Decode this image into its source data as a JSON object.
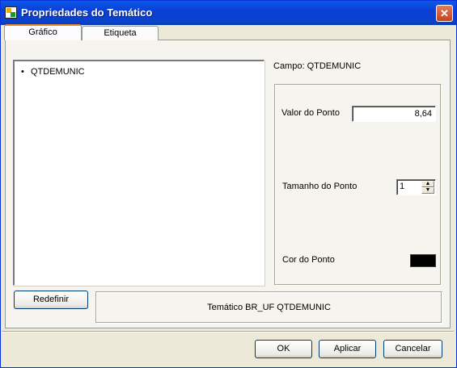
{
  "window": {
    "title": "Propriedades do Temático",
    "close_glyph": "✕"
  },
  "tabs": [
    {
      "label": "Gráfico",
      "active": true
    },
    {
      "label": "Etiqueta",
      "active": false
    }
  ],
  "fields_list": {
    "items": [
      {
        "bullet": "•",
        "label": "QTDEMUNIC"
      }
    ]
  },
  "campo": {
    "label": "Campo: QTDEMUNIC"
  },
  "props": {
    "valor_label": "Valor do Ponto",
    "valor_value": "8,64",
    "tamanho_label": "Tamanho do Ponto",
    "tamanho_value": "1",
    "cor_label": "Cor do Ponto",
    "cor_value": "#000000"
  },
  "buttons": {
    "redefinir": "Redefinir",
    "ok": "OK",
    "aplicar": "Aplicar",
    "cancelar": "Cancelar"
  },
  "status": {
    "text": "Temático BR_UF QTDEMUNIC"
  },
  "icons": {
    "app": "app-icon",
    "close": "close-icon",
    "spin_up": "spin-up-icon",
    "spin_down": "spin-down-icon"
  },
  "colors": {
    "title_bar": "#0b3fd6",
    "tab_highlight": "#e68b2c",
    "face": "#ece9d8"
  }
}
